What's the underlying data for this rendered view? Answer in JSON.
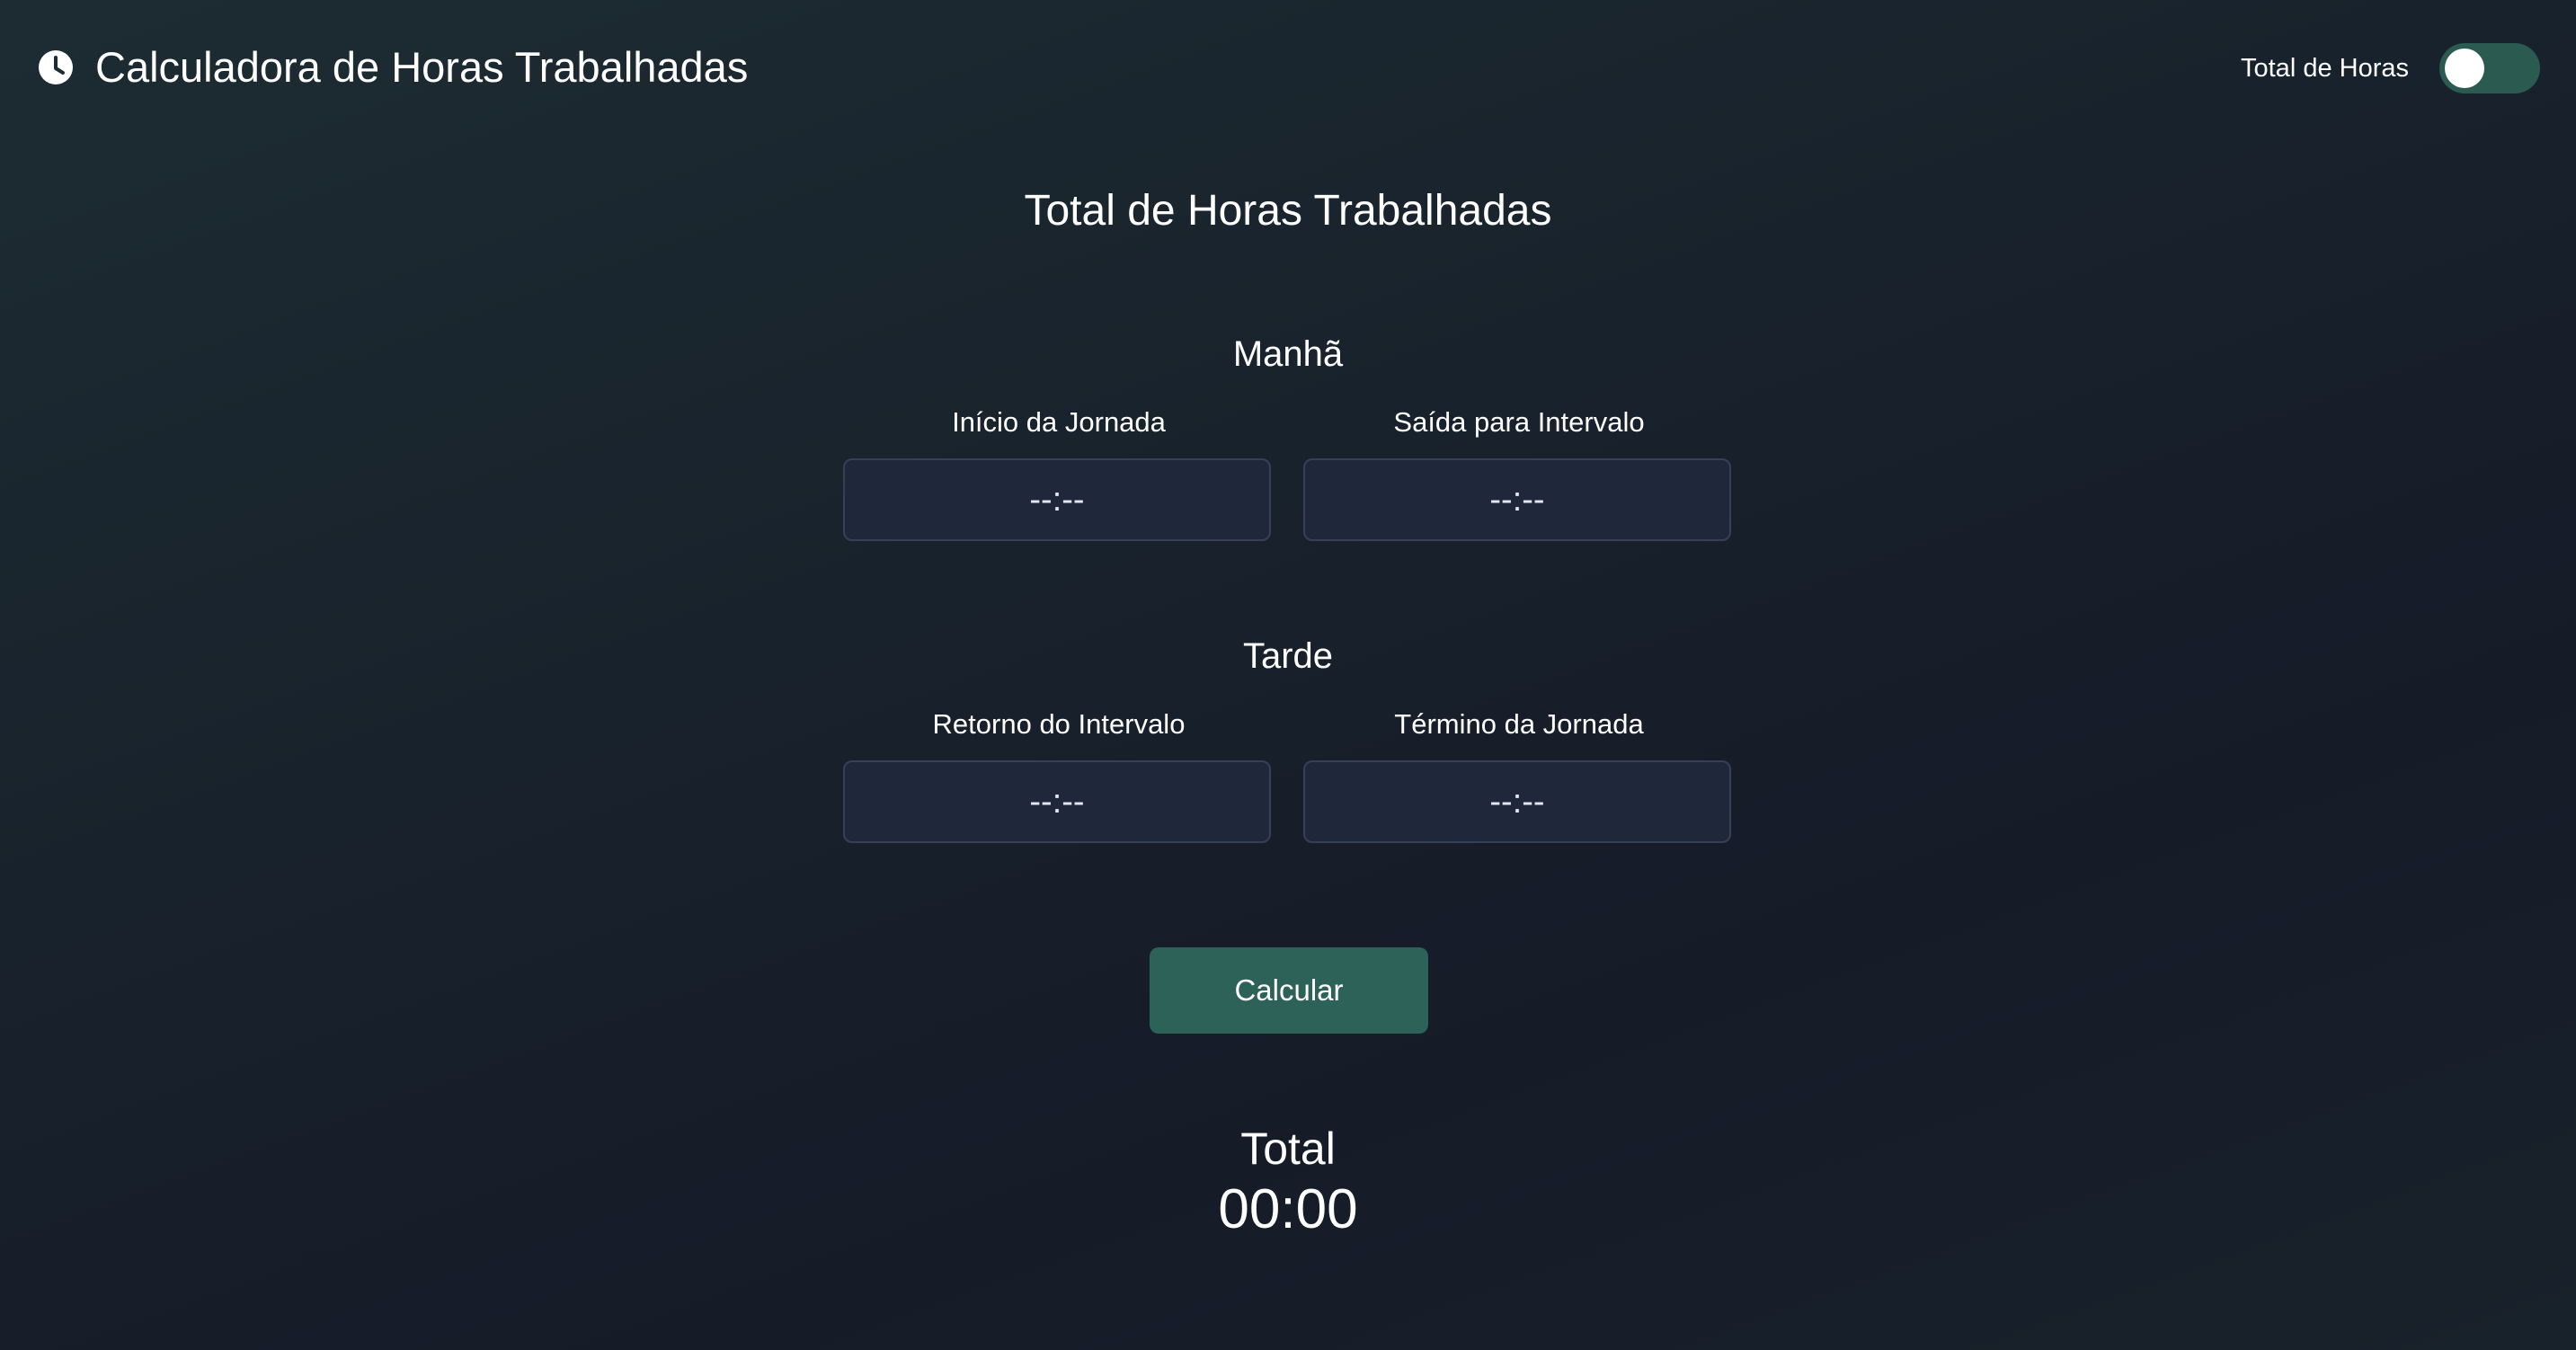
{
  "header": {
    "app_icon": "clock-icon",
    "title": "Calculadora de Horas Trabalhadas",
    "toggle_label": "Total de Horas",
    "toggle_on": false,
    "toggle_color": "#2a5a50"
  },
  "main": {
    "title": "Total de Horas Trabalhadas",
    "morning": {
      "title": "Manhã",
      "start": {
        "label": "Início da Jornada",
        "value": "--:--"
      },
      "break_out": {
        "label": "Saída para Intervalo",
        "value": "--:--"
      }
    },
    "afternoon": {
      "title": "Tarde",
      "break_return": {
        "label": "Retorno do Intervalo",
        "value": "--:--"
      },
      "end": {
        "label": "Término da Jornada",
        "value": "--:--"
      }
    },
    "calculate_label": "Calcular",
    "total_label": "Total",
    "total_value": "00:00"
  },
  "colors": {
    "accent": "#2d6258",
    "input_background": "#1f283b",
    "input_border": "#374155"
  }
}
